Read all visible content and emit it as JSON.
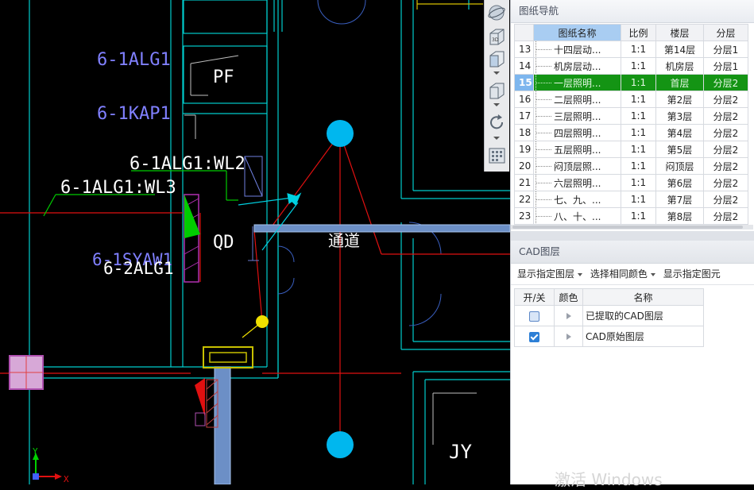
{
  "canvas": {
    "labels": {
      "alg1": "6-1ALG1",
      "kap1": "6-1KAP1",
      "pf": "PF",
      "wl2": "6-1ALG1:WL2",
      "wl3": "6-1ALG1:WL3",
      "qd": "QD",
      "syaw1": "6-1SYAW1",
      "alg1_2": "6-2ALG1",
      "corridor": "通道",
      "jy": "JY",
      "axis_y": "Y",
      "axis_x": "X"
    },
    "colors": {
      "background": "#000000",
      "wall": "#00d0d0",
      "text": "#8080ff",
      "white_text": "#ffffff",
      "red_line": "#e01010",
      "lamp": "#00b7ee",
      "duct": "#7aa3d8",
      "yellow": "#f0e000"
    }
  },
  "view_toolbar": {
    "buttons": [
      "orbit-icon",
      "3d-view-icon",
      "cube-view-icon",
      "box-view-icon",
      "rotate-icon",
      "grid-settings-icon"
    ]
  },
  "drawing_nav": {
    "title": "图纸导航",
    "columns": [
      "",
      "图纸名称",
      "比例",
      "楼层",
      "分层"
    ],
    "selected_column": 1,
    "rows": [
      {
        "num": "13",
        "name": "十四层动...",
        "scale": "1:1",
        "floor": "第14层",
        "layer": "分层1"
      },
      {
        "num": "14",
        "name": "机房层动...",
        "scale": "1:1",
        "floor": "机房层",
        "layer": "分层1"
      },
      {
        "num": "15",
        "name": "一层照明...",
        "scale": "1:1",
        "floor": "首层",
        "layer": "分层2",
        "active": true
      },
      {
        "num": "16",
        "name": "二层照明...",
        "scale": "1:1",
        "floor": "第2层",
        "layer": "分层2"
      },
      {
        "num": "17",
        "name": "三层照明...",
        "scale": "1:1",
        "floor": "第3层",
        "layer": "分层2"
      },
      {
        "num": "18",
        "name": "四层照明...",
        "scale": "1:1",
        "floor": "第4层",
        "layer": "分层2"
      },
      {
        "num": "19",
        "name": "五层照明...",
        "scale": "1:1",
        "floor": "第5层",
        "layer": "分层2"
      },
      {
        "num": "20",
        "name": "闷顶层照...",
        "scale": "1:1",
        "floor": "闷顶层",
        "layer": "分层2"
      },
      {
        "num": "21",
        "name": "六层照明...",
        "scale": "1:1",
        "floor": "第6层",
        "layer": "分层2"
      },
      {
        "num": "22",
        "name": "七、九、...",
        "scale": "1:1",
        "floor": "第7层",
        "layer": "分层2"
      },
      {
        "num": "23",
        "name": "八、十、...",
        "scale": "1:1",
        "floor": "第8层",
        "layer": "分层2"
      }
    ]
  },
  "cad_layers": {
    "title": "CAD图层",
    "toolbar": [
      "显示指定图层",
      "选择相同颜色",
      "显示指定图元"
    ],
    "columns": [
      "开/关",
      "颜色",
      "名称"
    ],
    "rows": [
      {
        "checked": false,
        "name": "已提取的CAD图层"
      },
      {
        "checked": true,
        "name": "CAD原始图层"
      }
    ]
  },
  "watermark": "激活 Windows"
}
